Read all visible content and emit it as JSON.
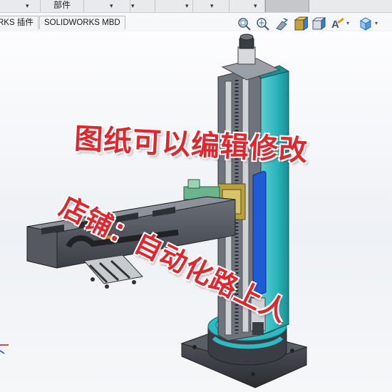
{
  "toolbar": {
    "part_label": "部件",
    "dropdown_arrows": [
      "▾",
      "▾",
      "▾",
      "▾",
      "▾",
      "▾"
    ]
  },
  "tabs": [
    {
      "label": "RKS 插件"
    },
    {
      "label": "SOLIDWORKS MBD"
    }
  ],
  "view_toolbar": {
    "icons": [
      "zoom-to-fit-icon",
      "zoom-to-area-icon",
      "previous-view-icon",
      "section-view-icon",
      "view-orientation-icon",
      "display-style-icon",
      "view-cube-icon"
    ],
    "carets": [
      "▾",
      "▾"
    ]
  },
  "watermark": {
    "line1": "图纸可以编辑修改",
    "line2": "店铺：自动化路上人",
    "color": "#e3262e"
  },
  "model": {
    "column_color": "#28b3b8",
    "base_color": "#3f4248",
    "arm_color": "#4a4e57",
    "rail_color": "#1e5bd6"
  }
}
